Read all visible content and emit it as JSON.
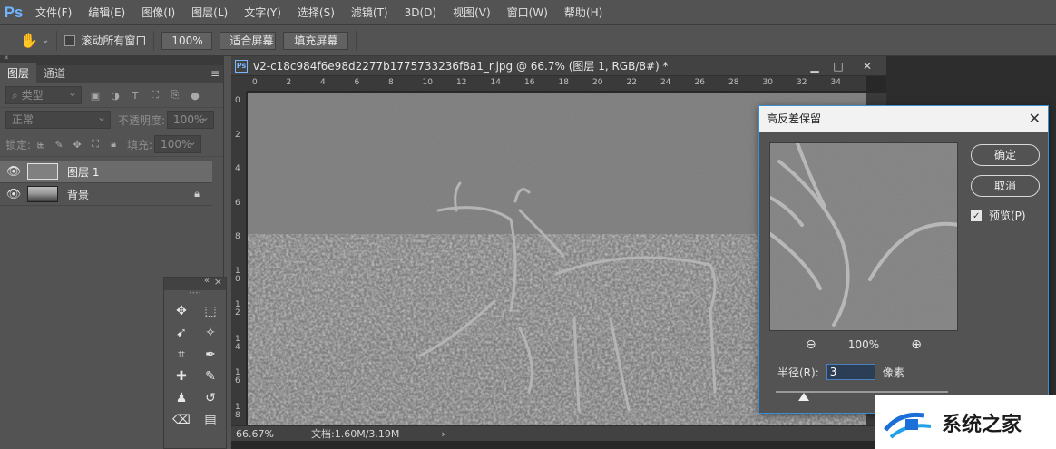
{
  "menubar": {
    "logo": "Ps",
    "items": [
      "文件(F)",
      "编辑(E)",
      "图像(I)",
      "图层(L)",
      "文字(Y)",
      "选择(S)",
      "滤镜(T)",
      "3D(D)",
      "视图(V)",
      "窗口(W)",
      "帮助(H)"
    ]
  },
  "options": {
    "scroll_all_label": "滚动所有窗口",
    "zoom_value": "100%",
    "fit_screen": "适合屏幕",
    "fill_screen": "填充屏幕"
  },
  "layers_panel": {
    "tabs": [
      "图层",
      "通道"
    ],
    "filter_kind": "类型",
    "blend_mode": "正常",
    "opacity_label": "不透明度:",
    "opacity_value": "100%",
    "lock_label": "锁定:",
    "fill_label": "填充:",
    "fill_value": "100%",
    "layers": [
      {
        "name": "图层 1",
        "selected": true,
        "visible": true
      },
      {
        "name": "背景",
        "selected": false,
        "visible": true,
        "locked": true
      }
    ]
  },
  "document": {
    "title": "v2-c18c984f6e98d2277b1775733236f8a1_r.jpg @ 66.7% (图层 1, RGB/8#) *",
    "ruler_top": [
      "0",
      "2",
      "4",
      "6",
      "8",
      "10",
      "12",
      "14",
      "16",
      "18",
      "20",
      "22",
      "24",
      "26",
      "28",
      "30",
      "32",
      "34"
    ],
    "ruler_left": [
      "0",
      "2",
      "4",
      "6",
      "8",
      "10",
      "12",
      "14",
      "16",
      "18"
    ],
    "zoom_status": "66.67%",
    "doc_size": "文档:1.60M/3.19M"
  },
  "dialog": {
    "title": "高反差保留",
    "ok": "确定",
    "cancel": "取消",
    "preview_label": "预览(P)",
    "preview_checked": true,
    "zoom": "100%",
    "radius_label": "半径(R):",
    "radius_value": "3",
    "unit": "像素",
    "slider_value": 3
  },
  "watermark": {
    "text": "系统之家"
  }
}
